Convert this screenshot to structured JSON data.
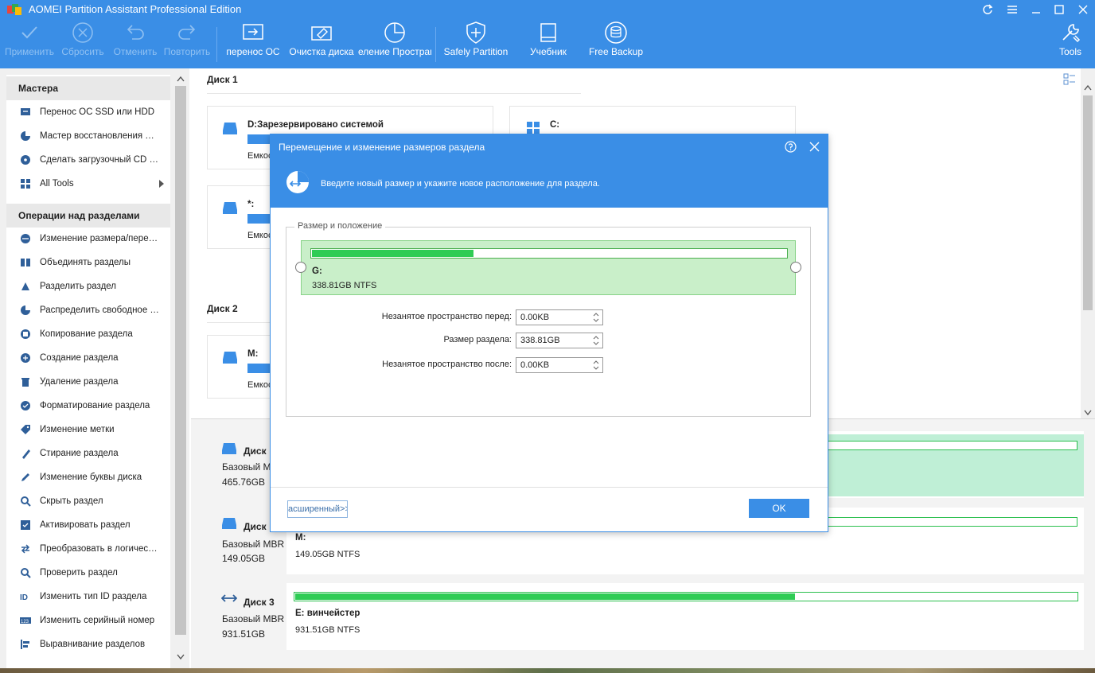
{
  "window": {
    "title": "AOMEI Partition Assistant Professional Edition"
  },
  "toolbar": {
    "items": [
      {
        "label": "Применить",
        "icon": "check-icon",
        "disabled": true
      },
      {
        "label": "Сбросить",
        "icon": "discard-icon",
        "disabled": true
      },
      {
        "label": "Отменить",
        "icon": "undo-icon",
        "disabled": true
      },
      {
        "label": "Повторить",
        "icon": "redo-icon",
        "disabled": true
      },
      {
        "label": "перенос ОС",
        "icon": "migrate-os-icon"
      },
      {
        "label": "Очистка диска",
        "icon": "wipe-disk-icon"
      },
      {
        "label": "еление Пространс",
        "icon": "allocate-space-icon"
      },
      {
        "label": "Safely Partition",
        "icon": "shield-icon"
      },
      {
        "label": "Учебник",
        "icon": "book-icon"
      },
      {
        "label": "Free Backup",
        "icon": "backup-icon"
      },
      {
        "label": "Tools",
        "icon": "tools-icon"
      }
    ]
  },
  "sidebar": {
    "wizards_header": "Мастера",
    "wizards": [
      {
        "label": "Перенос ОС SSD или HDD",
        "icon": "migrate-icon"
      },
      {
        "label": "Мастер восстановления раздела",
        "icon": "recovery-icon"
      },
      {
        "label": "Сделать загрузочный CD мастер",
        "icon": "bootable-cd-icon"
      },
      {
        "label": "All Tools",
        "icon": "grid-icon"
      }
    ],
    "ops_header": "Операции над разделами",
    "ops": [
      {
        "label": "Изменение размера/перемещение",
        "icon": "resize-icon"
      },
      {
        "label": "Объединять разделы",
        "icon": "merge-icon"
      },
      {
        "label": "Разделить раздел",
        "icon": "split-icon"
      },
      {
        "label": "Распределить свободное пространство",
        "icon": "pie-icon"
      },
      {
        "label": "Копирование раздела",
        "icon": "copy-icon"
      },
      {
        "label": "Создание раздела",
        "icon": "create-icon"
      },
      {
        "label": "Удаление раздела",
        "icon": "trash-icon"
      },
      {
        "label": "Форматирование раздела",
        "icon": "format-icon"
      },
      {
        "label": "Изменение метки",
        "icon": "tag-icon"
      },
      {
        "label": "Стирание раздела",
        "icon": "wipe-icon"
      },
      {
        "label": "Изменение буквы диска",
        "icon": "pencil-icon"
      },
      {
        "label": "Скрыть раздел",
        "icon": "search-icon"
      },
      {
        "label": "Активировать раздел",
        "icon": "activate-icon"
      },
      {
        "label": "Преобразовать в логический",
        "icon": "convert-icon"
      },
      {
        "label": "Проверить раздел",
        "icon": "check-partition-icon"
      },
      {
        "label": "Изменить тип ID раздела",
        "icon": "id-icon"
      },
      {
        "label": "Изменить серийный номер",
        "icon": "serial-icon"
      },
      {
        "label": "Выравнивание разделов",
        "icon": "align-icon"
      }
    ]
  },
  "main": {
    "disk1_header": "Диск 1",
    "disk2_header": "Диск 2",
    "cards": [
      {
        "name": "D:Зарезервировано системой",
        "cap": "Емкос"
      },
      {
        "name": "C:",
        "cap": ""
      },
      {
        "name": "*:",
        "cap": "Емкос"
      },
      {
        "name": "M:",
        "cap": "Емкос"
      }
    ]
  },
  "disks": [
    {
      "title": "Диск",
      "type": "Базовый M",
      "size": "465.76GB",
      "part_name": "",
      "part_info": "",
      "fill": 0.0
    },
    {
      "title": "Диск",
      "type": "Базовый MBR",
      "size": "149.05GB",
      "part_name": "M:",
      "part_info": "149.05GB NTFS",
      "fill": 0.0
    },
    {
      "title": "Диск 3",
      "type": "Базовый MBR",
      "size": "931.51GB",
      "part_name": "E: винчейстер",
      "part_info": "931.51GB NTFS",
      "fill": 0.64
    }
  ],
  "dialog": {
    "title": "Перемещение и изменение размеров раздела",
    "banner": "Введите новый размер и укажите новое расположение для раздела.",
    "group_title": "Размер и положение",
    "partition_name": "G:",
    "partition_info": "338.81GB NTFS",
    "used_fraction": 0.34,
    "fields": [
      {
        "label": "Незанятое пространство перед:",
        "value": "0.00KB"
      },
      {
        "label": "Размер раздела:",
        "value": "338.81GB"
      },
      {
        "label": "Незанятое пространство после:",
        "value": "0.00KB"
      }
    ],
    "advanced_label": "асширенный>>",
    "ok_label": "OK"
  },
  "colors": {
    "accent": "#3a8ee6",
    "bar_green": "#2ecc54",
    "partition_bg": "#c9efc9"
  }
}
